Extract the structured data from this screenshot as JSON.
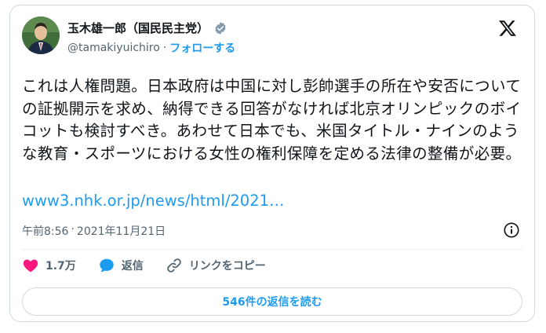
{
  "author": {
    "name": "玉木雄一郎（国民民主党）",
    "handle": "@tamakiyuichiro",
    "separator": "·",
    "follow_label": "フォローする"
  },
  "tweet": {
    "text": "これは人権問題。日本政府は中国に対し彭帥選手の所在や安否についての証拠開示を求め、納得できる回答がなければ北京オリンピックのボイコットも検討すべき。あわせて日本でも、米国タイトル・ナインのような教育・スポーツにおける女性の権利保障を定める法律の整備が必要。",
    "link": "www3.nhk.or.jp/news/html/2021…",
    "time": "午前8:56",
    "dot": "·",
    "date": "2021年11月21日"
  },
  "actions": {
    "likes": "1.7万",
    "reply_label": "返信",
    "copy_link_label": "リンクをコピー"
  },
  "read_replies_label": "546件の返信を読む",
  "colors": {
    "accent": "#1d9bf0",
    "like": "#f91880",
    "text": "#0f1419",
    "muted": "#536471"
  },
  "icons": [
    "verified-icon",
    "x-logo-icon",
    "info-icon",
    "heart-icon",
    "reply-icon",
    "link-icon"
  ]
}
